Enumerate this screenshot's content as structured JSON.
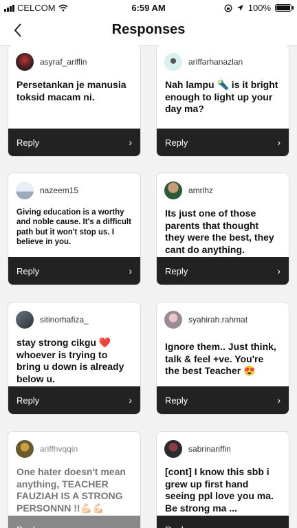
{
  "status": {
    "carrier": "CELCOM",
    "time": "6:59 AM",
    "battery": "100%"
  },
  "nav": {
    "title": "Responses"
  },
  "reply_label": "Reply",
  "cards": [
    {
      "user": "asyraf_ariffin",
      "message": "Persetankan je manusia toksid macam ni."
    },
    {
      "user": "ariffarhanazlan",
      "message": "Nah lampu 🔦 is it bright enough to light up your day ma?"
    },
    {
      "user": "nazeem15",
      "message": "Giving education is a worthy and noble cause. It's a difficult path but it won't stop us. I believe in you."
    },
    {
      "user": "amrlhz",
      "message": "Its just one of those parents that thought they were the best, they cant do anything."
    },
    {
      "user": "sitinorhafiza_",
      "message": "stay strong cikgu ❤️ whoever is trying to bring u down is already below u."
    },
    {
      "user": "syahirah.rahmat",
      "message": "Ignore them.. Just think, talk & feel +ve. You're the best Teacher 😍"
    },
    {
      "user": "ariffhvqqin",
      "message": "One hater doesn't mean anything, TEACHER FAUZIAH IS  A STRONG PERSONNN !!💪🏻💪🏻"
    },
    {
      "user": "sabrinariffin",
      "message": "[cont] I know this sbb i grew up first hand seeing ppl love you ma. Be strong ma ..."
    }
  ]
}
